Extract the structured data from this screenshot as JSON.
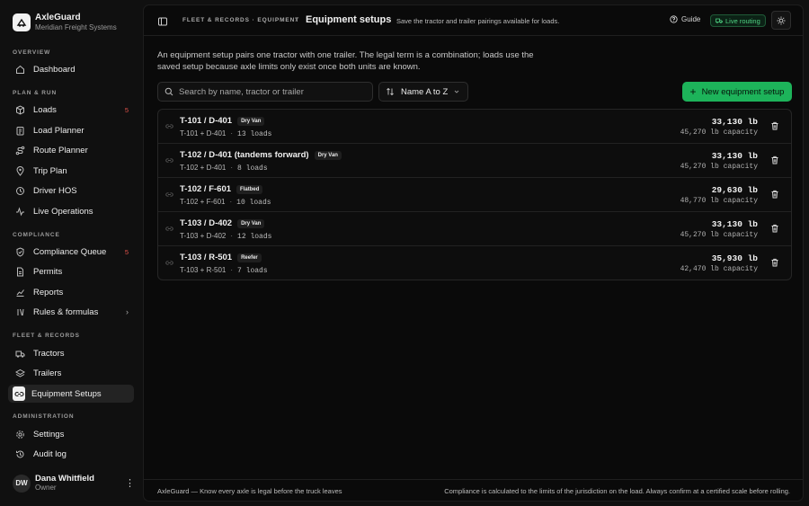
{
  "brand": {
    "name": "AxleGuard",
    "subtitle": "Meridian Freight Systems"
  },
  "sidebar": {
    "sections": {
      "overview": "OVERVIEW",
      "plan_run": "PLAN & RUN",
      "compliance": "COMPLIANCE",
      "fleet": "FLEET & RECORDS",
      "admin": "ADMINISTRATION"
    },
    "items": {
      "dashboard": {
        "label": "Dashboard"
      },
      "loads": {
        "label": "Loads",
        "badge": "5"
      },
      "load_planner": {
        "label": "Load Planner"
      },
      "route_planner": {
        "label": "Route Planner"
      },
      "trip_plan": {
        "label": "Trip Plan"
      },
      "driver_hos": {
        "label": "Driver HOS"
      },
      "live_operations": {
        "label": "Live Operations"
      },
      "compliance_queue": {
        "label": "Compliance Queue",
        "badge": "5"
      },
      "permits": {
        "label": "Permits"
      },
      "reports": {
        "label": "Reports"
      },
      "rules_formulas": {
        "label": "Rules & formulas"
      },
      "tractors": {
        "label": "Tractors"
      },
      "trailers": {
        "label": "Trailers"
      },
      "equipment_setups": {
        "label": "Equipment Setups"
      },
      "settings": {
        "label": "Settings"
      },
      "audit_log": {
        "label": "Audit log"
      }
    }
  },
  "user": {
    "initials": "DW",
    "name": "Dana Whitfield",
    "role": "Owner"
  },
  "header": {
    "breadcrumb_parent": "FLEET & RECORDS · EQUIPMENT",
    "breadcrumb_separator": "›",
    "title": "Equipment setups",
    "subtitle": "Save the tractor and trailer pairings available for loads.",
    "guide_label": "Guide",
    "routing_status": "Live routing"
  },
  "intro": "An equipment setup pairs one tractor with one trailer. The legal term is a combination; loads use the saved setup because axle limits only exist once both units are known.",
  "toolbar": {
    "search_placeholder": "Search by name, tractor or trailer",
    "sort_label": "Name A to Z",
    "new_button_label": "New equipment setup"
  },
  "setups": [
    {
      "title": "T-101 / D-401",
      "tag": "Dry Van",
      "pair": "T-101 + D-401",
      "loads": "13 loads",
      "weight": "33,130 lb",
      "capacity": "45,270 lb capacity"
    },
    {
      "title": "T-102 / D-401 (tandems forward)",
      "tag": "Dry Van",
      "pair": "T-102 + D-401",
      "loads": "8 loads",
      "weight": "33,130 lb",
      "capacity": "45,270 lb capacity"
    },
    {
      "title": "T-102 / F-601",
      "tag": "Flatbed",
      "pair": "T-102 + F-601",
      "loads": "10 loads",
      "weight": "29,630 lb",
      "capacity": "48,770 lb capacity"
    },
    {
      "title": "T-103 / D-402",
      "tag": "Dry Van",
      "pair": "T-103 + D-402",
      "loads": "12 loads",
      "weight": "33,130 lb",
      "capacity": "45,270 lb capacity"
    },
    {
      "title": "T-103 / R-501",
      "tag": "Reefer",
      "pair": "T-103 + R-501",
      "loads": "7 loads",
      "weight": "35,930 lb",
      "capacity": "42,470 lb capacity"
    }
  ],
  "footer": {
    "left": "AxleGuard — Know every axle is legal before the truck leaves",
    "right": "Compliance is calculated to the limits of the jurisdiction on the load. Always confirm at a certified scale before rolling."
  },
  "colors": {
    "accent": "#1db35a",
    "badge": "#e0524a",
    "routing": "#4fd483",
    "background": "#0a0a0a"
  }
}
